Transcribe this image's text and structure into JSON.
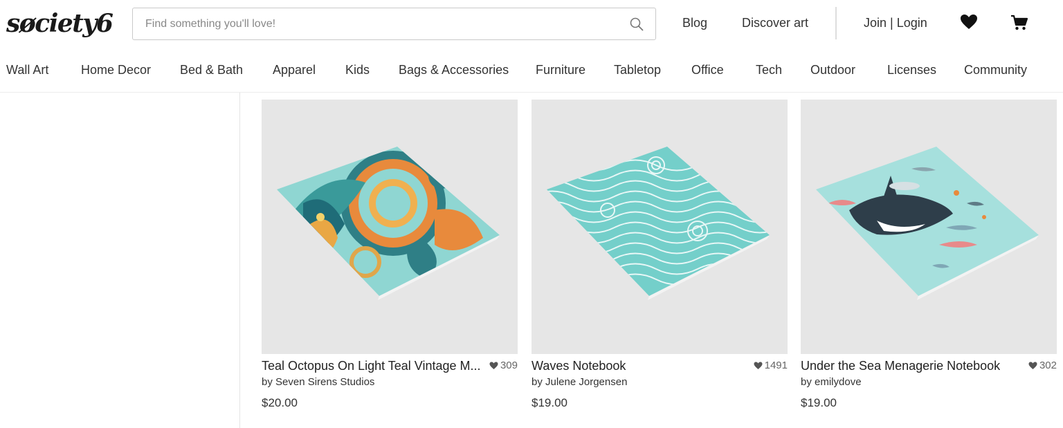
{
  "header": {
    "logo": "søciety6",
    "search_placeholder": "Find something you'll love!",
    "links": {
      "blog": "Blog",
      "discover": "Discover art",
      "join_login": "Join | Login"
    }
  },
  "nav": {
    "categories": [
      "Wall Art",
      "Home Decor",
      "Bed & Bath",
      "Apparel",
      "Kids",
      "Bags & Accessories",
      "Furniture",
      "Tabletop",
      "Office",
      "Tech",
      "Outdoor",
      "Licenses",
      "Community"
    ]
  },
  "products": [
    {
      "title": "Teal Octopus On Light Teal Vintage M...",
      "likes": "309",
      "artist": "by Seven Sirens Studios",
      "price": "$20.00",
      "image": "octopus-notebook-image"
    },
    {
      "title": "Waves Notebook",
      "likes": "1491",
      "artist": "by Julene Jorgensen",
      "price": "$19.00",
      "image": "waves-notebook-image"
    },
    {
      "title": "Under the Sea Menagerie Notebook",
      "likes": "302",
      "artist": "by emilydove",
      "price": "$19.00",
      "image": "sea-menagerie-notebook-image"
    }
  ],
  "colors": {
    "notebook_teal": "#8fd6d2",
    "background_grey": "#e6e6e6",
    "text": "#222222"
  }
}
